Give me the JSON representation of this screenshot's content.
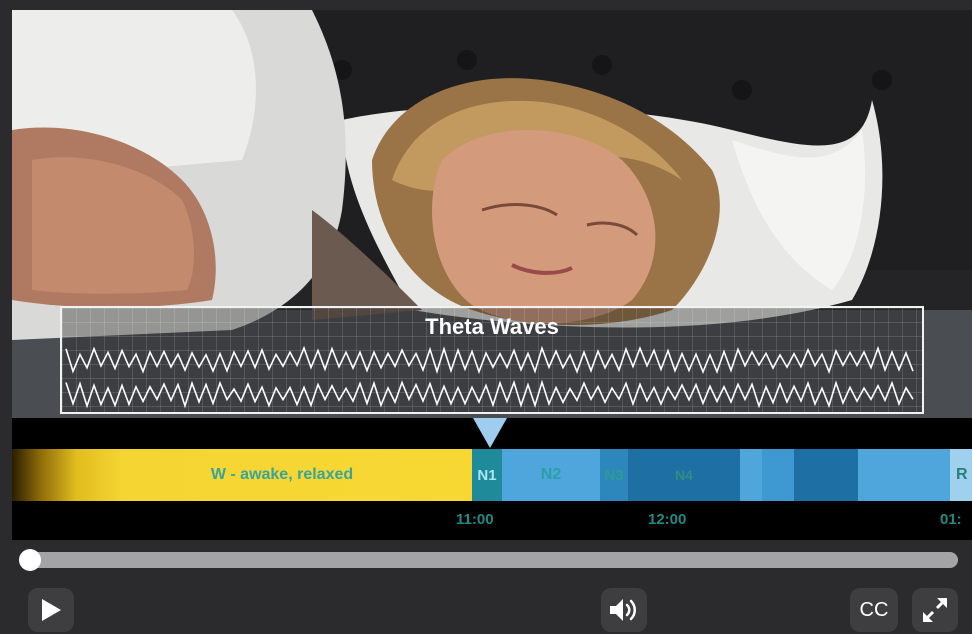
{
  "overlay": {
    "title": "Theta Waves"
  },
  "stages": {
    "wake": "W - awake, relaxed",
    "n1": "N1",
    "n2": "N2",
    "n3": "N3",
    "n4": "N4",
    "next_partial": "R"
  },
  "timeline": {
    "t1": "11:00",
    "t2": "12:00",
    "t3": "01:"
  },
  "progress": {
    "fraction": 0.0
  },
  "controls": {
    "play_icon": "play-icon",
    "volume_icon": "volume-icon",
    "cc_label": "CC",
    "fullscreen_icon": "fullscreen-icon"
  },
  "colors": {
    "wake_yellow": "#f7d833",
    "n1_teal": "#1f8a9a",
    "light_blue": "#4ea6dc",
    "deep_blue": "#1d6fa4",
    "time_label": "#1f8a86",
    "control_bg": "#3e3e41"
  }
}
